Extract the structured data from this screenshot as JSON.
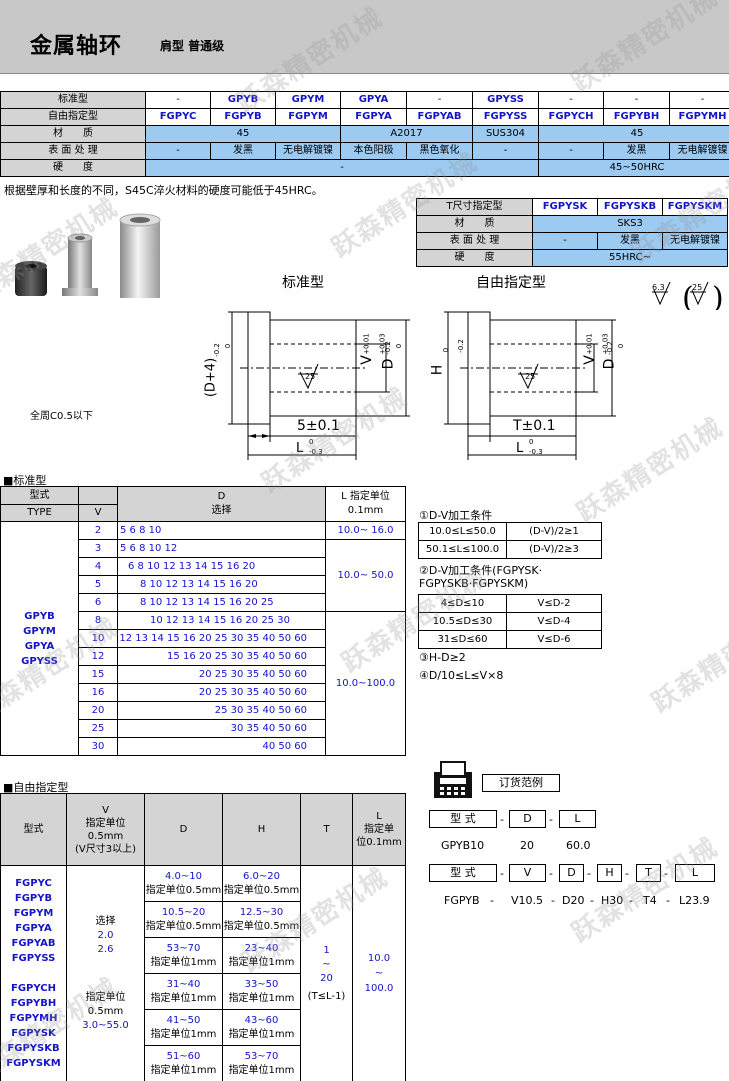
{
  "header": {
    "title": "金属轴环",
    "subtitle": "肩型 普通级"
  },
  "watermark": "跃森精密机械",
  "spec_table": {
    "row_labels": [
      "标准型",
      "自由指定型",
      "材　　质",
      "表 面 处 理",
      "硬　　度"
    ],
    "standard": [
      "-",
      "GPYB",
      "GPYM",
      "GPYA",
      "-",
      "GPYSS",
      "-",
      "-",
      "-"
    ],
    "free": [
      "FGPYC",
      "FGPYB",
      "FGPYM",
      "FGPYA",
      "FGPYAB",
      "FGPYSS",
      "FGPYCH",
      "FGPYBH",
      "FGPYMH"
    ],
    "material": [
      "45",
      "A2017",
      "SUS304",
      "45"
    ],
    "surface": [
      "-",
      "发黑",
      "无电解镀镍",
      "本色阳极",
      "黑色氧化",
      "-",
      "-",
      "发黑",
      "无电解镀镍"
    ],
    "hardness": [
      "-",
      "45~50HRC"
    ]
  },
  "note_hardness": "根据壁厚和长度的不同，S45C淬火材料的硬度可能低于45HRC。",
  "t_table": {
    "row_labels": [
      "T尺寸指定型",
      "材　　质",
      "表 面 处 理",
      "硬　　度"
    ],
    "types": [
      "FGPYSK",
      "FGPYSKB",
      "FGPYSKM"
    ],
    "material": "SKS3",
    "surface": [
      "-",
      "发黑",
      "无电解镀镍"
    ],
    "hardness": "55HRC~"
  },
  "drawing": {
    "label_standard": "标准型",
    "label_free": "自由指定型",
    "chamfer_note": "全周C0.5以下",
    "roughness_a": "6.3",
    "roughness_b": "25",
    "tol_std_flange": "(D+4)",
    "tol_free_flange": "H",
    "dim_v": "V",
    "dim_d": "D",
    "dim_l": "L",
    "std_shoulder": "5±0.1",
    "free_shoulder": "T±0.1",
    "finish_mark": "25",
    "tol_up_d4": "0",
    "tol_lo_d4": "-0.2",
    "tol_up_v": "+0.03",
    "tol_lo_v": "+0.01",
    "tol_up_d": "0",
    "tol_lo_d": "-0.2",
    "tol_up_l": "0",
    "tol_lo_l": "-0.3"
  },
  "standard_section": {
    "title": "■标准型",
    "head_type": "型式",
    "head_type_en": "TYPE",
    "head_v": "V",
    "head_d": "D",
    "head_d2": "选择",
    "head_l": "L 指定单位",
    "head_l2": "0.1mm",
    "types": [
      "GPYB",
      "GPYM",
      "GPYA",
      "GPYSS"
    ],
    "rows": [
      {
        "v": "2",
        "d": "5 6 8 10"
      },
      {
        "v": "3",
        "d": "5 6 8 10 12"
      },
      {
        "v": "4",
        "d": "6 8 10 12 13 14 15 16 20"
      },
      {
        "v": "5",
        "d": "8 10 12 13 14 15 16 20"
      },
      {
        "v": "6",
        "d": "8 10 12 13 14 15 16 20 25"
      },
      {
        "v": "8",
        "d": "10 12 13 14 15 16 20 25 30"
      },
      {
        "v": "10",
        "d": "12 13 14 15 16 20 25 30 35 40 50 60"
      },
      {
        "v": "12",
        "d": "15 16 20 25 30 35 40 50 60"
      },
      {
        "v": "15",
        "d": "20 25 30 35 40 50 60"
      },
      {
        "v": "16",
        "d": "20 25 30 35 40 50 60"
      },
      {
        "v": "20",
        "d": "25 30 35 40 50 60"
      },
      {
        "v": "25",
        "d": "30 35 40 50 60"
      },
      {
        "v": "30",
        "d": "40 50 60"
      }
    ],
    "l_ranges": [
      "10.0~ 16.0",
      "10.0~ 50.0",
      "10.0~100.0"
    ]
  },
  "conditions": {
    "c1_title": "①D-V加工条件",
    "c1_rows": [
      [
        "10.0≤L≤50.0",
        "(D-V)/2≥1"
      ],
      [
        "50.1≤L≤100.0",
        "(D-V)/2≥3"
      ]
    ],
    "c2_title": "②D-V加工条件(FGPYSK·",
    "c2_title2": "FGPYSKB·FGPYSKM)",
    "c2_rows": [
      [
        "4≤D≤10",
        "V≤D-2"
      ],
      [
        "10.5≤D≤30",
        "V≤D-4"
      ],
      [
        "31≤D≤60",
        "V≤D-6"
      ]
    ],
    "c3": "③H-D≥2",
    "c4": "④D/10≤L≤V×8"
  },
  "free_section": {
    "title": "■自由指定型",
    "head_type": "型式",
    "head_v": [
      "V",
      "指定单位",
      "0.5mm",
      "(V尺寸3以上)"
    ],
    "head_d": "D",
    "head_h": "H",
    "head_t": "T",
    "head_l": [
      "L",
      "指定单",
      "位0.1mm"
    ],
    "types_a": [
      "FGPYC",
      "FGPYB",
      "FGPYM",
      "FGPYA",
      "FGPYAB",
      "FGPYSS"
    ],
    "types_b": [
      "FGPYCH",
      "FGPYBH",
      "FGPYMH",
      "FGPYSK",
      "FGPYSKB",
      "FGPYSKM"
    ],
    "v_a": [
      "选择",
      "2.0",
      "2.6"
    ],
    "v_b": [
      "指定单位",
      "0.5mm",
      "3.0~55.0"
    ],
    "d_rows": [
      [
        "4.0~10",
        "指定单位0.5mm"
      ],
      [
        "10.5~20",
        "指定单位0.5mm"
      ],
      [
        "53~70",
        "指定单位1mm"
      ],
      [
        "31~40",
        "指定单位1mm"
      ],
      [
        "41~50",
        "指定单位1mm"
      ],
      [
        "51~60",
        "指定单位1mm"
      ]
    ],
    "h_rows": [
      [
        "6.0~20",
        "指定单位0.5mm"
      ],
      [
        "12.5~30",
        "指定单位0.5mm"
      ],
      [
        "23~40",
        "指定单位1mm"
      ],
      [
        "33~50",
        "指定单位1mm"
      ],
      [
        "43~60",
        "指定单位1mm"
      ],
      [
        "53~70",
        "指定单位1mm"
      ]
    ],
    "t": [
      "1",
      "~",
      "20",
      "(T≤L-1)"
    ],
    "l": [
      "10.0",
      "~",
      "100.0"
    ]
  },
  "order": {
    "title": "订货范例",
    "row1_labels": [
      "型 式",
      "D",
      "L"
    ],
    "row1_values": [
      "GPYB10",
      "20",
      "60.0"
    ],
    "row2_labels": [
      "型 式",
      "V",
      "D",
      "H",
      "T",
      "L"
    ],
    "row2_values": [
      "FGPYB",
      "V10.5",
      "D20",
      "H30",
      "T4",
      "L23.9"
    ],
    "sep": "-"
  },
  "colors": {
    "header_gray": "#c8c8c8",
    "cell_gray": "#d4d4d4",
    "cell_blue": "#9ccaf0",
    "type_blue": "#1414c8"
  }
}
